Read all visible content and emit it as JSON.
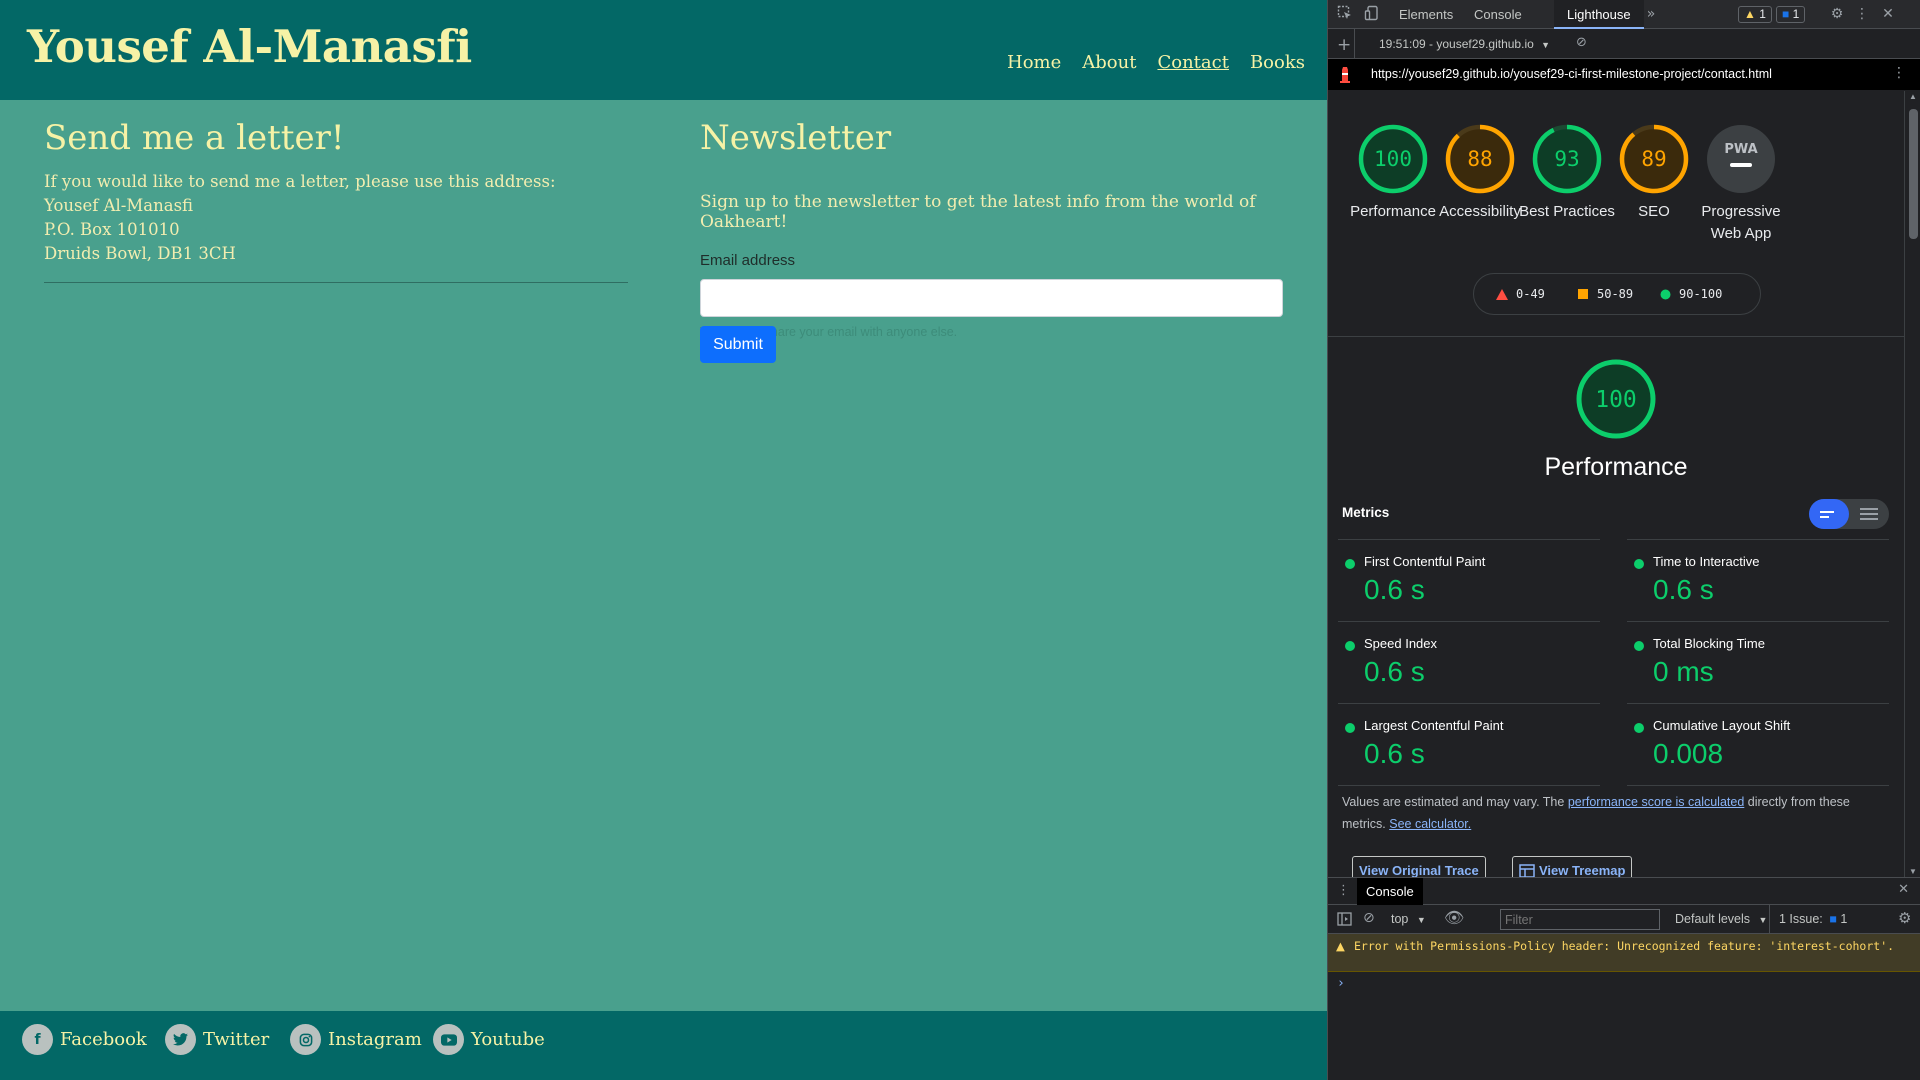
{
  "site": {
    "brand": "Yousef Al-Manasfi",
    "nav": [
      "Home",
      "About",
      "Contact",
      "Books"
    ],
    "letter": {
      "title": "Send me a letter!",
      "lines": [
        "If you would like to send me a letter, please use this address:",
        "Yousef Al-Manasfi",
        "P.O. Box 101010",
        "Druids Bowl, DB1 3CH"
      ]
    },
    "newsletter": {
      "title": "Newsletter",
      "description": "Sign up to the newsletter to get the latest info from the world of Oakheart!",
      "email_label": "Email address",
      "email_value": "",
      "help_text": "We'll never share your email with anyone else.",
      "submit_label": "Submit"
    },
    "social": [
      "Facebook",
      "Twitter",
      "Instagram",
      "Youtube"
    ]
  },
  "devtools": {
    "tabs": [
      "Elements",
      "Console",
      "Lighthouse"
    ],
    "active_tab": "Lighthouse",
    "warning_count": "1",
    "issue_count": "1",
    "report_selector": "19:51:09 - yousef29.github.io",
    "url": "https://yousef29.github.io/yousef29-ci-first-milestone-project/contact.html",
    "gauges": [
      {
        "score": "100",
        "label": "Performance",
        "color": "#0cce6b"
      },
      {
        "score": "88",
        "label": "Accessibility",
        "color": "#ffa400"
      },
      {
        "score": "93",
        "label": "Best Practices",
        "color": "#0cce6b"
      },
      {
        "score": "89",
        "label": "SEO",
        "color": "#ffa400"
      }
    ],
    "pwa": {
      "label": "Progressive Web App",
      "badge": "PWA"
    },
    "legend": [
      "0-49",
      "50-89",
      "90-100"
    ],
    "perf": {
      "score": "100",
      "title": "Performance"
    },
    "metrics_title": "Metrics",
    "metrics": [
      {
        "name": "First Contentful Paint",
        "value": "0.6 s"
      },
      {
        "name": "Time to Interactive",
        "value": "0.6 s"
      },
      {
        "name": "Speed Index",
        "value": "0.6 s"
      },
      {
        "name": "Total Blocking Time",
        "value": "0 ms"
      },
      {
        "name": "Largest Contentful Paint",
        "value": "0.6 s"
      },
      {
        "name": "Cumulative Layout Shift",
        "value": "0.008"
      }
    ],
    "note": {
      "pre": "Values are estimated and may vary. The ",
      "link1": "performance score is calculated",
      "mid": " directly from these metrics. ",
      "link2": "See calculator."
    },
    "buttons": {
      "trace": "View Original Trace",
      "treemap": "View Treemap"
    },
    "drawer": {
      "tab": "Console",
      "context": "top",
      "filter_placeholder": "Filter",
      "levels": "Default levels",
      "issues": "1 Issue:",
      "issues_count": "1",
      "warning": "Error with Permissions-Policy header: Unrecognized feature: 'interest-cohort'."
    },
    "colors": {
      "pass": "#0cce6b",
      "average": "#ffa400",
      "fail": "#ff4e42"
    }
  }
}
